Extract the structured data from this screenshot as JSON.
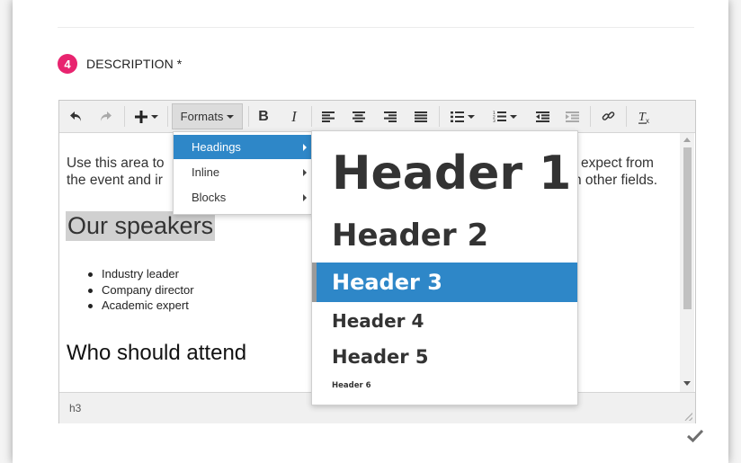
{
  "section": {
    "step": "4",
    "title": "DESCRIPTION *"
  },
  "toolbar": {
    "formats_label": "Formats",
    "bold": "B",
    "italic": "I",
    "clear_format": "Tx"
  },
  "content": {
    "para_left_line1": "Use this area to",
    "para_left_line2": "the event and ir",
    "para_right_line1": "expect from",
    "para_right_line2": "n other fields.",
    "heading_speakers": "Our speakers",
    "bullets": [
      "Industry leader",
      "Company director",
      "Academic expert"
    ],
    "heading_attend": "Who should attend"
  },
  "statusbar": {
    "path": "h3"
  },
  "formats_menu": {
    "items": [
      {
        "label": "Headings",
        "active": true
      },
      {
        "label": "Inline",
        "active": false
      },
      {
        "label": "Blocks",
        "active": false
      }
    ]
  },
  "headings_menu": {
    "items": [
      "Header 1",
      "Header 2",
      "Header 3",
      "Header 4",
      "Header 5",
      "Header 6"
    ],
    "selected": "Header 3"
  },
  "colors": {
    "accent": "#2e87c8",
    "badge": "#e8246f",
    "highlight": "#d0d0d0"
  }
}
